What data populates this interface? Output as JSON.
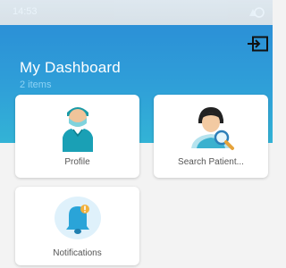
{
  "status": {
    "time": "14:53"
  },
  "header": {
    "title": "My Dashboard",
    "subtitle": "2 items"
  },
  "cards": [
    {
      "label": "Profile",
      "icon": "doctor-avatar-icon"
    },
    {
      "label": "Search Patient...",
      "icon": "search-patient-icon"
    },
    {
      "label": "Notifications",
      "icon": "bell-icon"
    }
  ],
  "colors": {
    "header_blue": "#2a8ad6",
    "header_cyan": "#33b3d6",
    "card_bg": "#ffffff",
    "label_text": "#555555"
  }
}
